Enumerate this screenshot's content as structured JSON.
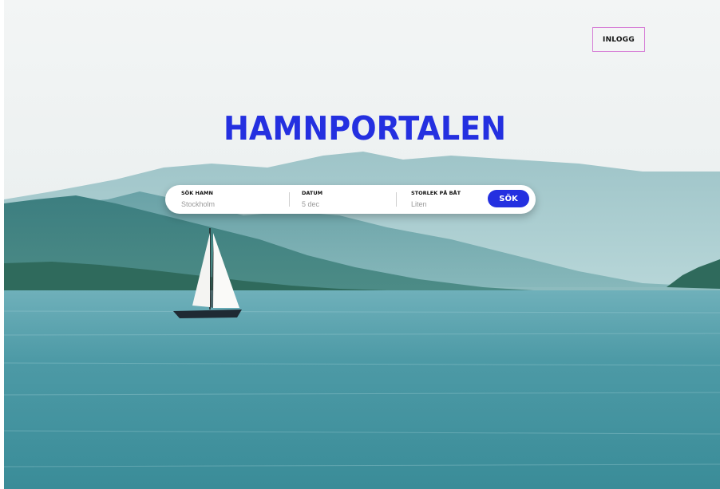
{
  "header": {
    "login_label": "INLOGG"
  },
  "hero": {
    "title": "HAMNPORTALEN",
    "image": "lake-mountains-sailboat"
  },
  "search": {
    "harbor": {
      "label": "SÖK HAMN",
      "placeholder": "Stockholm"
    },
    "date": {
      "label": "DATUM",
      "placeholder": "5 dec"
    },
    "boat_size": {
      "label": "STORLEK PÅ BÅT",
      "placeholder": "Liten"
    },
    "button_label": "SÖK"
  },
  "colors": {
    "accent": "#2430e0",
    "login_border": "#d67fd6"
  }
}
